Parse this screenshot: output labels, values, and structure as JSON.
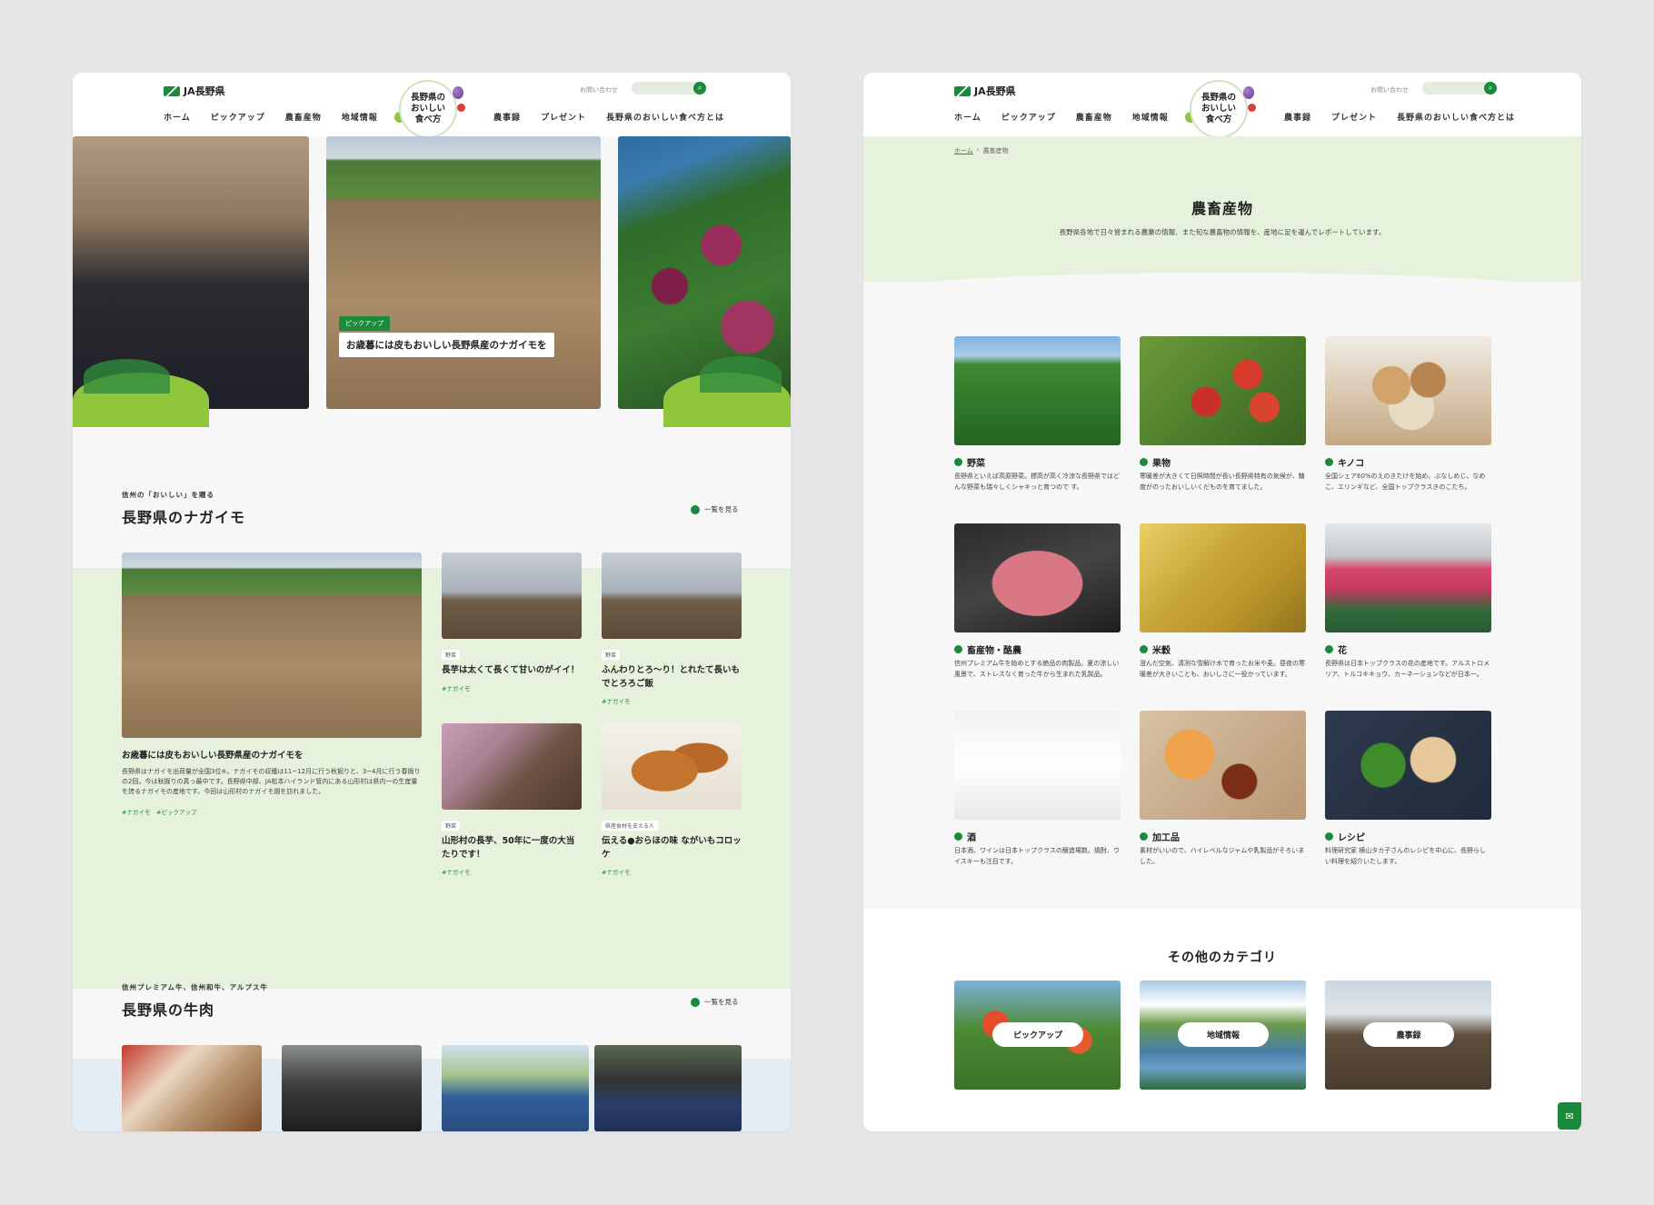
{
  "header": {
    "brand": "JA長野県",
    "logo_lines": [
      "長野県の",
      "おいしい",
      "食べ方"
    ],
    "nav_left": [
      "ホーム",
      "ピックアップ",
      "農畜産物",
      "地域情報"
    ],
    "nav_right": [
      "農事録",
      "プレゼント",
      "長野県のおいしい食べ方とは"
    ],
    "contact": "お問い合わせ",
    "search_placeholder": ""
  },
  "left": {
    "hero": {
      "pill": "ピックアップ",
      "caption": "お歳暮には皮もおいしい長野県産のナガイモを"
    },
    "nagaimo": {
      "kicker": "信州の「おいしい」を贈る",
      "title": "長野県のナガイモ",
      "more": "一覧を見る",
      "main": {
        "title": "お歳暮には皮もおいしい長野県産のナガイモを",
        "text": "長野県はナガイモ出荷量が全国3位※。ナガイモの収穫は11~12月に行う秋掘りと、3~4月に行う春掘りの2回。今は秋掘りの真っ最中です。長野県中部、JA松本ハイランド管内にある山形村は県内一の生産量を誇るナガイモの産地です。今回は山形村のナガイモ畑を訪れました。",
        "tags": [
          "#ナガイモ",
          "#ピックアップ"
        ]
      },
      "cards": [
        {
          "cat": "野菜",
          "title": "長芋は太くて長くて甘いのがイイ！",
          "tag": "#ナガイモ"
        },
        {
          "cat": "野菜",
          "title": "ふんわりとろ〜り！とれたて長いもでとろろご飯",
          "tag": "#ナガイモ"
        },
        {
          "cat": "野菜",
          "title": "山形村の長芋、50年に一度の大当たりです！",
          "tag": "#ナガイモ"
        },
        {
          "cat": "県産食材を支える人",
          "title": "伝える●おらほの味 ながいもコロッケ",
          "tag": "#ナガイモ"
        }
      ]
    },
    "beef": {
      "kicker": "信州プレミアム牛、信州和牛、アルプス牛",
      "title": "長野県の牛肉",
      "more": "一覧を見る"
    }
  },
  "right": {
    "breadcrumb": [
      "ホーム",
      "農畜産物"
    ],
    "title": "農畜産物",
    "lead": "長野県各地で日々営まれる農業の情報、また旬な農畜物の情報を、産地に足を運んでレポートしています。",
    "categories": [
      {
        "name": "野菜",
        "desc": "長野県といえば高原野菜。標高が高く冷涼な長野県ではどんな野菜も瑞々しくシャキっと育つので す。"
      },
      {
        "name": "果物",
        "desc": "寒暖差が大きくて日照時間が長い長野県特有の気候が、糖度がのったおいしいくだものを育てました。"
      },
      {
        "name": "キノコ",
        "desc": "全国シェア60%のえのきたけを始め、ぶなしめじ、なめこ、エリンギなど、全国トップクラスきのこたち。"
      },
      {
        "name": "畜産物・酪農",
        "desc": "信州プレミアム牛を始めとする絶品の肉製品。夏の涼しい風景で、ストレスなく育った牛から生まれた乳製品。"
      },
      {
        "name": "米穀",
        "desc": "澄んだ空気、清冽な雪解け水で育ったお米や麦。昼夜の寒暖差が大きいことも、おいしさに一役かっています。"
      },
      {
        "name": "花",
        "desc": "長野県は日本トップクラスの花の産地です。アルストロメリア、トルコキキョウ、カーネーションなどが日本一。"
      },
      {
        "name": "酒",
        "desc": "日本酒、ワインは日本トップクラスの醸造場数。焼酎、ウイスキーも注目です。"
      },
      {
        "name": "加工品",
        "desc": "素材がいいので、ハイレベルなジャムや乳製品がそろいました。"
      },
      {
        "name": "レシピ",
        "desc": "料理研究家 横山タカ子さんのレシピを中心に、長野らしい料理を紹介いたします。"
      }
    ],
    "other_title": "その他のカテゴリ",
    "other": [
      "ピックアップ",
      "地域情報",
      "農事録"
    ]
  },
  "colors": {
    "accent": "#1b8a3c",
    "band": "#e7f2dc",
    "page": "#f7f7f7"
  },
  "icons": {
    "search": "search-icon",
    "mail": "mail-icon",
    "bullet": "dot-icon"
  }
}
